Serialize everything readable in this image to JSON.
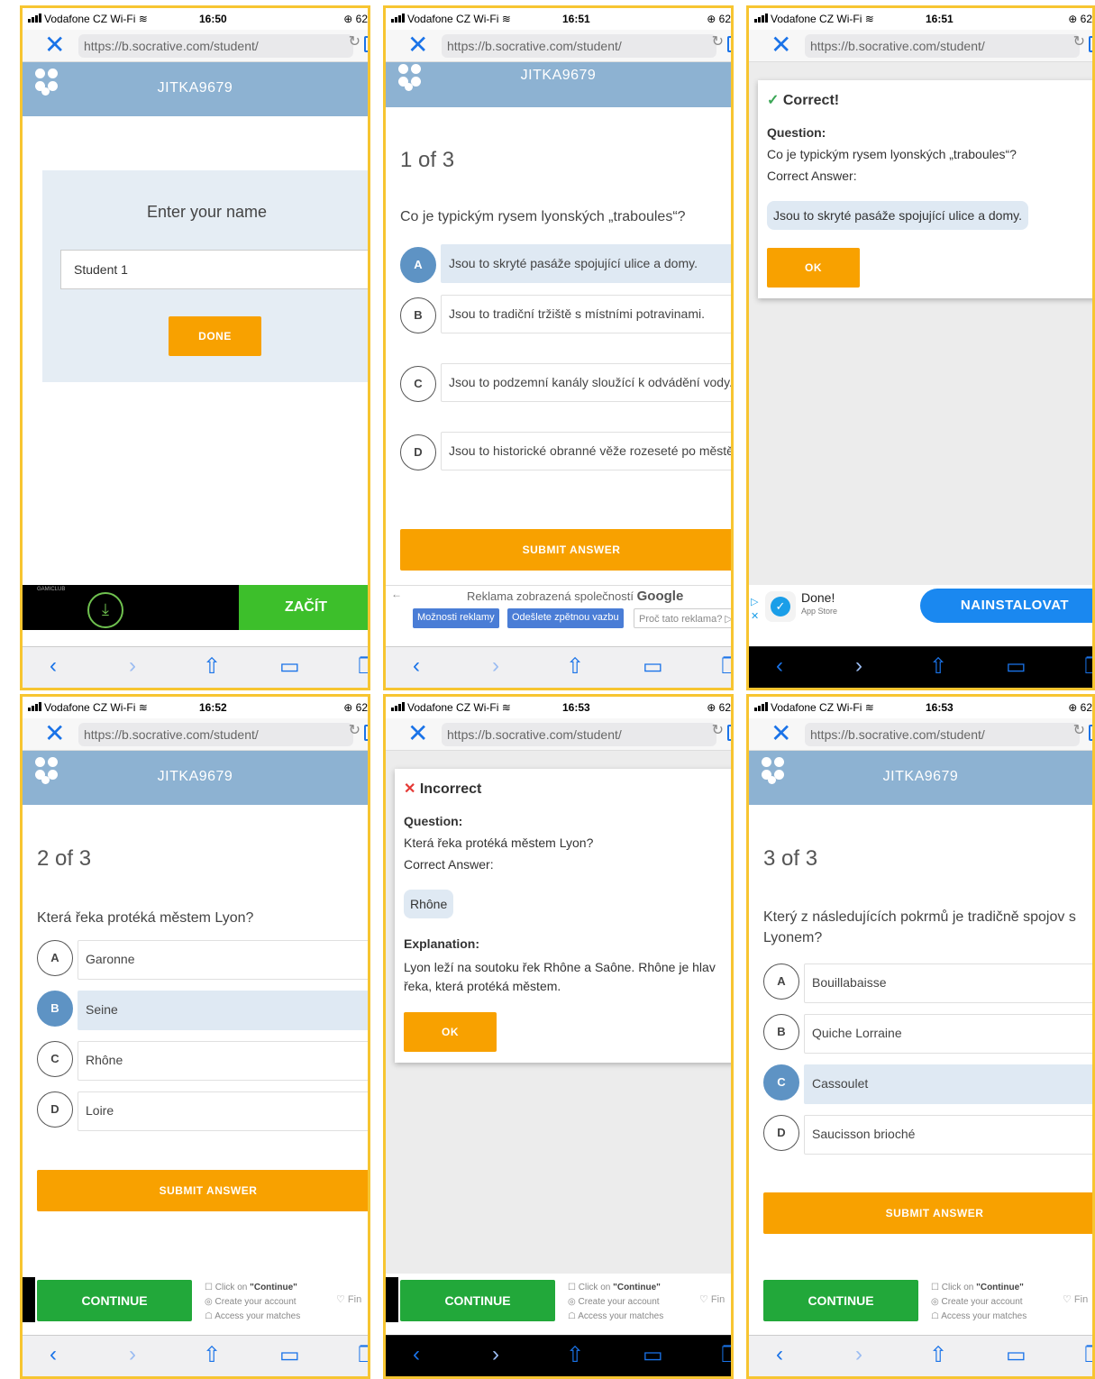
{
  "common": {
    "carrier": "Vodafone CZ Wi-Fi",
    "battery": "62",
    "url": "https://b.socrative.com/student/",
    "room": "JITKA9679",
    "reload": "↻",
    "close": "✕"
  },
  "panels": {
    "p1": {
      "time": "16:50",
      "prompt": "Enter your name",
      "name_value": "Student 1",
      "done": "DONE",
      "ad_brand": "GAMICLUB",
      "ad_button": "ZAČÍT"
    },
    "p2": {
      "time": "16:51",
      "progress": "1 of 3",
      "question": "Co je typickým rysem lyonských „traboules“?",
      "choices": [
        {
          "letter": "A",
          "text": "Jsou to skryté pasáže spojující ulice a domy."
        },
        {
          "letter": "B",
          "text": "Jsou to tradiční tržiště s místními potravinami."
        },
        {
          "letter": "C",
          "text": "Jsou to podzemní kanály sloužící k odvádění vody."
        },
        {
          "letter": "D",
          "text": "Jsou to historické obranné věže rozeseté po městě."
        }
      ],
      "submit": "SUBMIT ANSWER",
      "ad_label": "Reklama zobrazená společností",
      "ad_google": "Google",
      "ad_btn1": "Možnosti reklamy",
      "ad_btn2": "Odešlete zpětnou vazbu",
      "ad_btn3": "Proč tato reklama? ▷"
    },
    "p3": {
      "time": "16:51",
      "status": "Correct!",
      "question_label": "Question:",
      "question": "Co je typickým rysem lyonských „traboules“?",
      "correct_label": "Correct Answer:",
      "answer": "Jsou to skryté pasáže spojující ulice a domy.",
      "ok": "OK",
      "ad_app": "Done!",
      "ad_store": "App Store",
      "ad_install": "NAINSTALOVAT"
    },
    "p4": {
      "time": "16:52",
      "progress": "2 of 3",
      "question": "Která řeka protéká městem Lyon?",
      "choices": [
        {
          "letter": "A",
          "text": "Garonne"
        },
        {
          "letter": "B",
          "text": "Seine"
        },
        {
          "letter": "C",
          "text": "Rhône"
        },
        {
          "letter": "D",
          "text": "Loire"
        }
      ],
      "submit": "SUBMIT ANSWER"
    },
    "p5": {
      "time": "16:53",
      "status": "Incorrect",
      "question_label": "Question:",
      "question": "Která řeka protéká městem Lyon?",
      "correct_label": "Correct Answer:",
      "answer": "Rhône",
      "explanation_label": "Explanation:",
      "explanation_line1": "Lyon leží na soutoku řek Rhône a Saône. Rhône je hlav",
      "explanation_line2": "řeka, která protéká městem.",
      "ok": "OK"
    },
    "p6": {
      "time": "16:53",
      "progress": "3 of 3",
      "question": "Který z následujících pokrmů je tradičně spojov s Lyonem?",
      "choices": [
        {
          "letter": "A",
          "text": "Bouillabaisse"
        },
        {
          "letter": "B",
          "text": "Quiche Lorraine"
        },
        {
          "letter": "C",
          "text": "Cassoulet"
        },
        {
          "letter": "D",
          "text": "Saucisson brioché"
        }
      ],
      "submit": "SUBMIT ANSWER"
    }
  },
  "continue_ad": {
    "button": "CONTINUE",
    "line1_prefix": "Click on ",
    "line1_bold": "\"Continue\"",
    "line2": "Create your account",
    "line3": "Access your matches",
    "trail": "Fin"
  },
  "colors": {
    "header": "#8db2d2",
    "accent_orange": "#f8a100",
    "selected": "#5e93c4",
    "frame": "#f7c531"
  }
}
